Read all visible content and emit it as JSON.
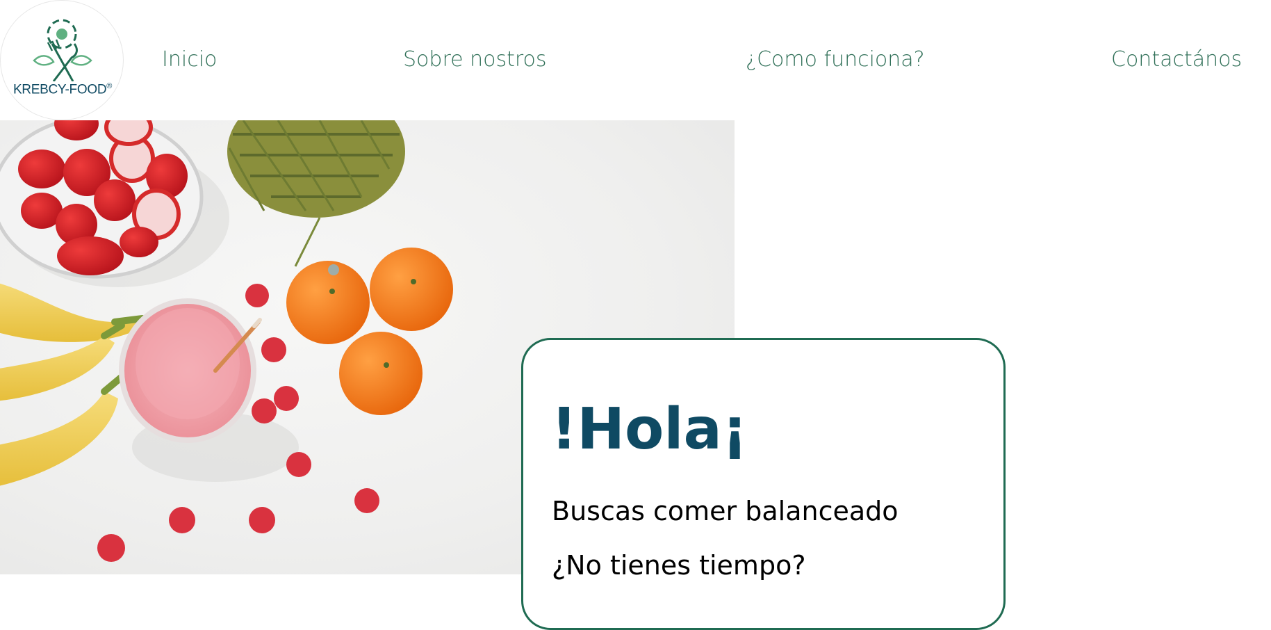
{
  "brand": {
    "name": "KREBCY-FOOD",
    "registered": "®"
  },
  "nav": {
    "items": [
      {
        "label": "Inicio"
      },
      {
        "label": "Sobre nostros"
      },
      {
        "label": "¿Como funciona?"
      },
      {
        "label": "Contactános"
      }
    ]
  },
  "hero": {
    "image": "fruits-smoothie-photo"
  },
  "card": {
    "title": "!Hola¡",
    "lines": [
      "Buscas comer balanceado",
      "¿No tienes tiempo?"
    ]
  },
  "colors": {
    "nav_text": "#2f6f57",
    "brand_blue": "#0f4a63",
    "card_border": "#1f6b52",
    "logo_green": "#5fb081"
  }
}
